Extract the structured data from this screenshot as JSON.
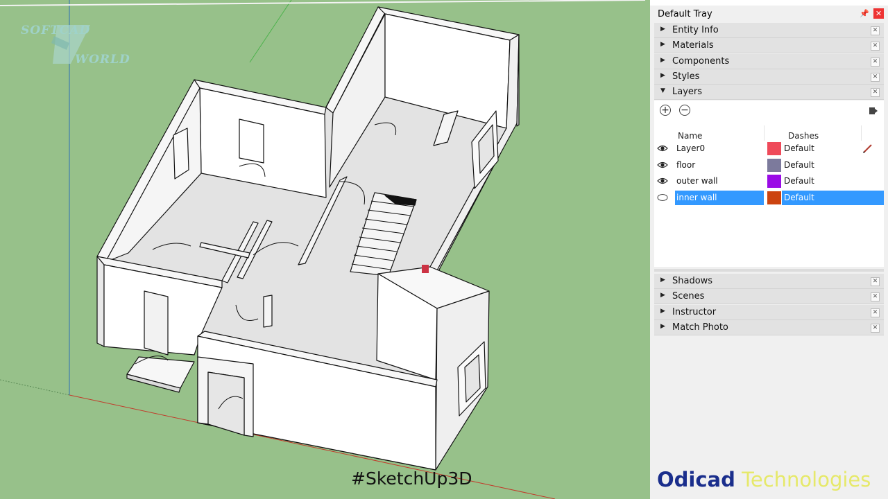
{
  "watermark": {
    "line1": "SOFTCAD",
    "line2": "WORLD"
  },
  "overlay": {
    "hashtag": "#SketchUp3D"
  },
  "tray": {
    "title": "Default Tray",
    "panels_top": [
      "Entity Info",
      "Materials",
      "Components",
      "Styles"
    ],
    "layers_panel": "Layers",
    "columns": {
      "name": "Name",
      "dashes": "Dashes"
    },
    "layers": [
      {
        "name": "Layer0",
        "color": "#ef4a5a",
        "dashes": "Default",
        "visible": true,
        "current": true
      },
      {
        "name": "floor",
        "color": "#7c7a9c",
        "dashes": "Default",
        "visible": true
      },
      {
        "name": "outer wall",
        "color": "#9a0be6",
        "dashes": "Default",
        "visible": true
      },
      {
        "name": "inner wall",
        "color": "#cc4410",
        "dashes": "Default",
        "visible": false,
        "selected": true
      }
    ],
    "panels_bottom": [
      "Shadows",
      "Scenes",
      "Instructor",
      "Match Photo"
    ]
  },
  "brand": {
    "part1": "Odicad",
    "part2": "Technologies"
  }
}
